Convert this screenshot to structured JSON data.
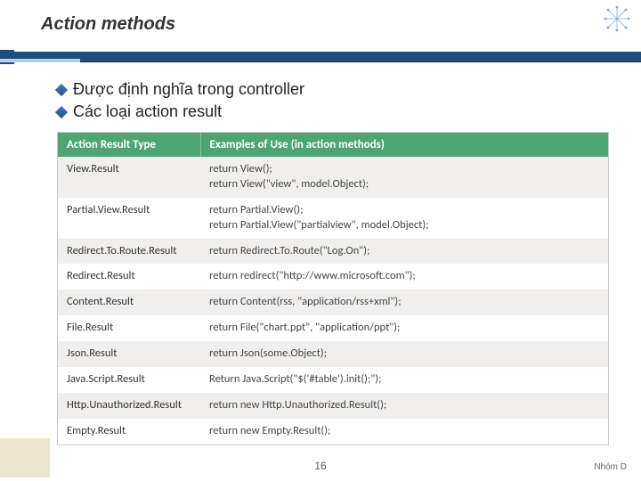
{
  "slide": {
    "title": "Action methods",
    "page_number": "16",
    "author": "Nhóm D"
  },
  "bullets": [
    {
      "text": "Được định nghĩa trong controller"
    },
    {
      "text": "Các loại action result"
    }
  ],
  "table": {
    "headers": [
      "Action Result Type",
      "Examples of Use (in action methods)"
    ],
    "rows": [
      {
        "type": "View.Result",
        "example": "return View();\nreturn View(\"view\", model.Object);"
      },
      {
        "type": "Partial.View.Result",
        "example": "return Partial.View();\nreturn Partial.View(\"partialview\", model.Object);"
      },
      {
        "type": "Redirect.To.Route.Result",
        "example": "return Redirect.To.Route(\"Log.On\");"
      },
      {
        "type": "Redirect.Result",
        "example": "return redirect(\"http://www.microsoft.com\");"
      },
      {
        "type": "Content.Result",
        "example": "return Content(rss, \"application/rss+xml\");"
      },
      {
        "type": "File.Result",
        "example": "return File(\"chart.ppt\", \"application/ppt\");"
      },
      {
        "type": "Json.Result",
        "example": "return Json(some.Object);"
      },
      {
        "type": "Java.Script.Result",
        "example": "Return Java.Script(\"$('#table').init();\");"
      },
      {
        "type": "Http.Unauthorized.Result",
        "example": "return new Http.Unauthorized.Result();"
      },
      {
        "type": "Empty.Result",
        "example": "return new Empty.Result();"
      }
    ]
  },
  "icons": {
    "asterisk": "asterisk-icon",
    "diamond": "diamond-bullet"
  }
}
